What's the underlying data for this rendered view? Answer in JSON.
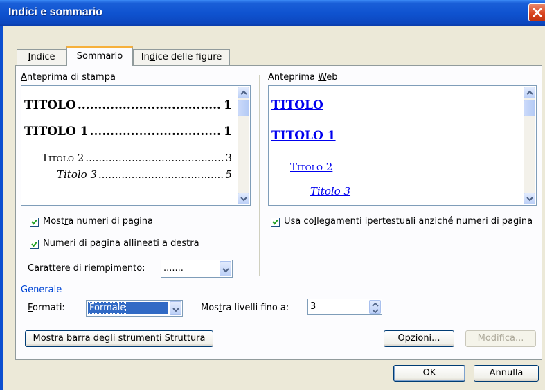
{
  "window": {
    "title": "Indici e sommario"
  },
  "tabs": [
    {
      "pre": "",
      "key": "I",
      "post": "ndice"
    },
    {
      "pre": "",
      "key": "S",
      "post": "ommario"
    },
    {
      "pre": "In",
      "key": "d",
      "post": "ice delle figure"
    }
  ],
  "print_preview": {
    "label_pre": "",
    "label_key": "A",
    "label_post": "nteprima di stampa",
    "entries": [
      {
        "text": "TITOLO",
        "page": "1"
      },
      {
        "text": "TITOLO 1",
        "page": "1"
      },
      {
        "text": "Titolo 2",
        "page": "3"
      },
      {
        "text": "Titolo 3",
        "page": "5"
      }
    ]
  },
  "web_preview": {
    "label_pre": "Anteprima ",
    "label_key": "W",
    "label_post": "eb",
    "entries": [
      "TITOLO",
      "TITOLO 1",
      "Titolo 2",
      "Titolo 3"
    ]
  },
  "options": {
    "show_page_numbers": {
      "pre": "Most",
      "key": "r",
      "post": "a numeri di pagina",
      "checked": true
    },
    "right_align": {
      "pre": "Numeri di ",
      "key": "p",
      "post": "agina allineati a destra",
      "checked": true
    },
    "use_hyperlinks": {
      "pre": "Usa co",
      "key": "l",
      "post": "legamenti ipertestuali anziché numeri di pagina",
      "checked": true
    },
    "tab_leader": {
      "pre": "",
      "key": "C",
      "post": "arattere di riempimento:",
      "value": "......."
    }
  },
  "general": {
    "title": "Generale",
    "formats_label": {
      "pre": "",
      "key": "F",
      "post": "ormati:"
    },
    "formats_value": "Formale",
    "levels_label": {
      "pre": "Mos",
      "key": "t",
      "post": "ra livelli fino a:"
    },
    "levels_value": "3"
  },
  "buttons": {
    "outline_toolbar": {
      "pre": "Mostra barra degli strumenti Str",
      "key": "u",
      "post": "ttura"
    },
    "options": {
      "pre": "",
      "key": "O",
      "post": "pzioni..."
    },
    "modify": "Modifica...",
    "ok": "OK",
    "cancel": "Annulla"
  },
  "colors": {
    "title_bar": "#0c47bf",
    "accent_tab": "#f6b03b",
    "link": "#0000ee",
    "selection": "#316ac5"
  }
}
